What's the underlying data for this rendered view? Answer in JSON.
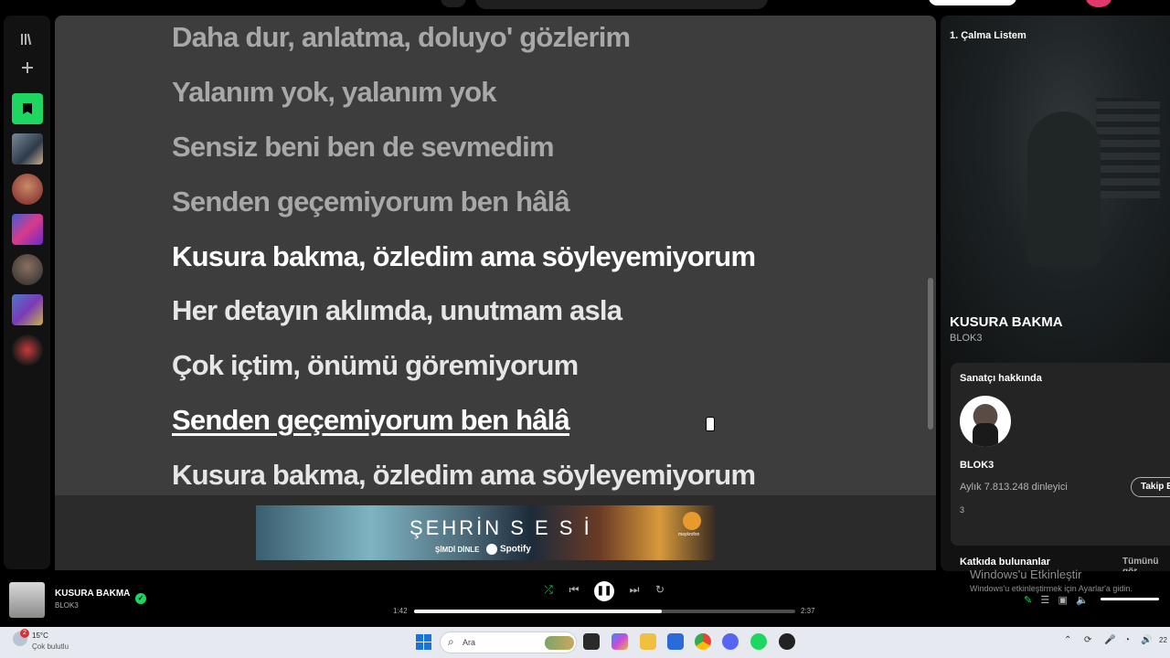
{
  "lyrics": [
    {
      "text": "Daha dur, anlatma, doluyo' gözlerim",
      "state": "past"
    },
    {
      "text": "Yalanım yok, yalanım yok",
      "state": "past"
    },
    {
      "text": "Sensiz beni ben de sevmedim",
      "state": "past"
    },
    {
      "text": "Senden geçemiyorum ben hâlâ",
      "state": "past"
    },
    {
      "text": "Kusura bakma, özledim ama söyleyemiyorum",
      "state": "active"
    },
    {
      "text": "Her detayın aklımda, unutmam asla",
      "state": "upcoming"
    },
    {
      "text": "Çok içtim, önümü göremiyorum",
      "state": "upcoming"
    },
    {
      "text": "Senden geçemiyorum ben hâlâ",
      "state": "hover"
    },
    {
      "text": "Kusura bakma, özledim ama söyleyemiyorum",
      "state": "upcoming"
    }
  ],
  "banner": {
    "title": "ŞEHRİN S E S İ",
    "subtitle": "ŞİMDİ DİNLE",
    "brand": "Spotify",
    "logo_text": "maykrofon"
  },
  "right_panel": {
    "playlist_name": "1. Çalma Listem",
    "track_title": "KUSURA BAKMA",
    "track_artist": "BLOK3",
    "about_heading": "Sanatçı hakkında",
    "artist_name": "BLOK3",
    "monthly_listeners": "Aylık 7.813.248 dinleyici",
    "follow_label": "Takip Et",
    "bio": "3",
    "credits_heading": "Katkıda bulunanlar",
    "show_all": "Tümünü gör"
  },
  "player": {
    "title": "KUSURA BAKMA",
    "artist": "BLOK3",
    "elapsed": "1:42",
    "duration": "2:37",
    "progress_fraction": 0.65
  },
  "watermark": {
    "line1": "Windows'u Etkinleştir",
    "line2": "Windows'u etkinleştirmek için Ayarlar'a gidin."
  },
  "taskbar": {
    "badge": "2",
    "temperature": "15°C",
    "condition": "Çok bulutlu",
    "search_placeholder": "Ara",
    "clock": "22"
  },
  "colors": {
    "accent": "#1ed760",
    "lyrics_bg": "#3d3d3d"
  }
}
